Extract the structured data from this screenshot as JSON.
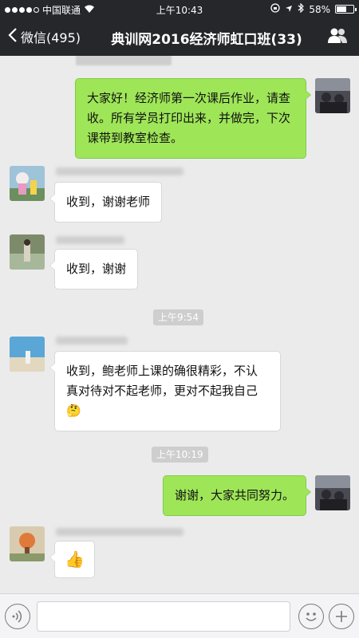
{
  "status_bar": {
    "carrier": "中国联通",
    "time": "上午10:43",
    "battery": "58%",
    "battery_level": 0.58
  },
  "nav": {
    "back_label": "微信(495)",
    "title": "典训网2016经济师虹口班(33)"
  },
  "messages": {
    "m1": "大家好！经济师第一次课后作业，请查收。所有学员打印出来，并做完，下次课带到教室检查。",
    "m2": "收到，谢谢老师",
    "m3": "收到，谢谢",
    "m4": "收到，鲍老师上课的确很精彩，不认真对待对不起老师，更对不起我自己🤔",
    "m5": "谢谢，大家共同努力。",
    "m6": "👍"
  },
  "times": {
    "t1": "上午9:54",
    "t2": "上午10:19"
  },
  "colors": {
    "bar_bg": "#25272b",
    "chat_bg": "#ebebeb",
    "bubble_green": "#9ee658",
    "bubble_white": "#ffffff"
  }
}
